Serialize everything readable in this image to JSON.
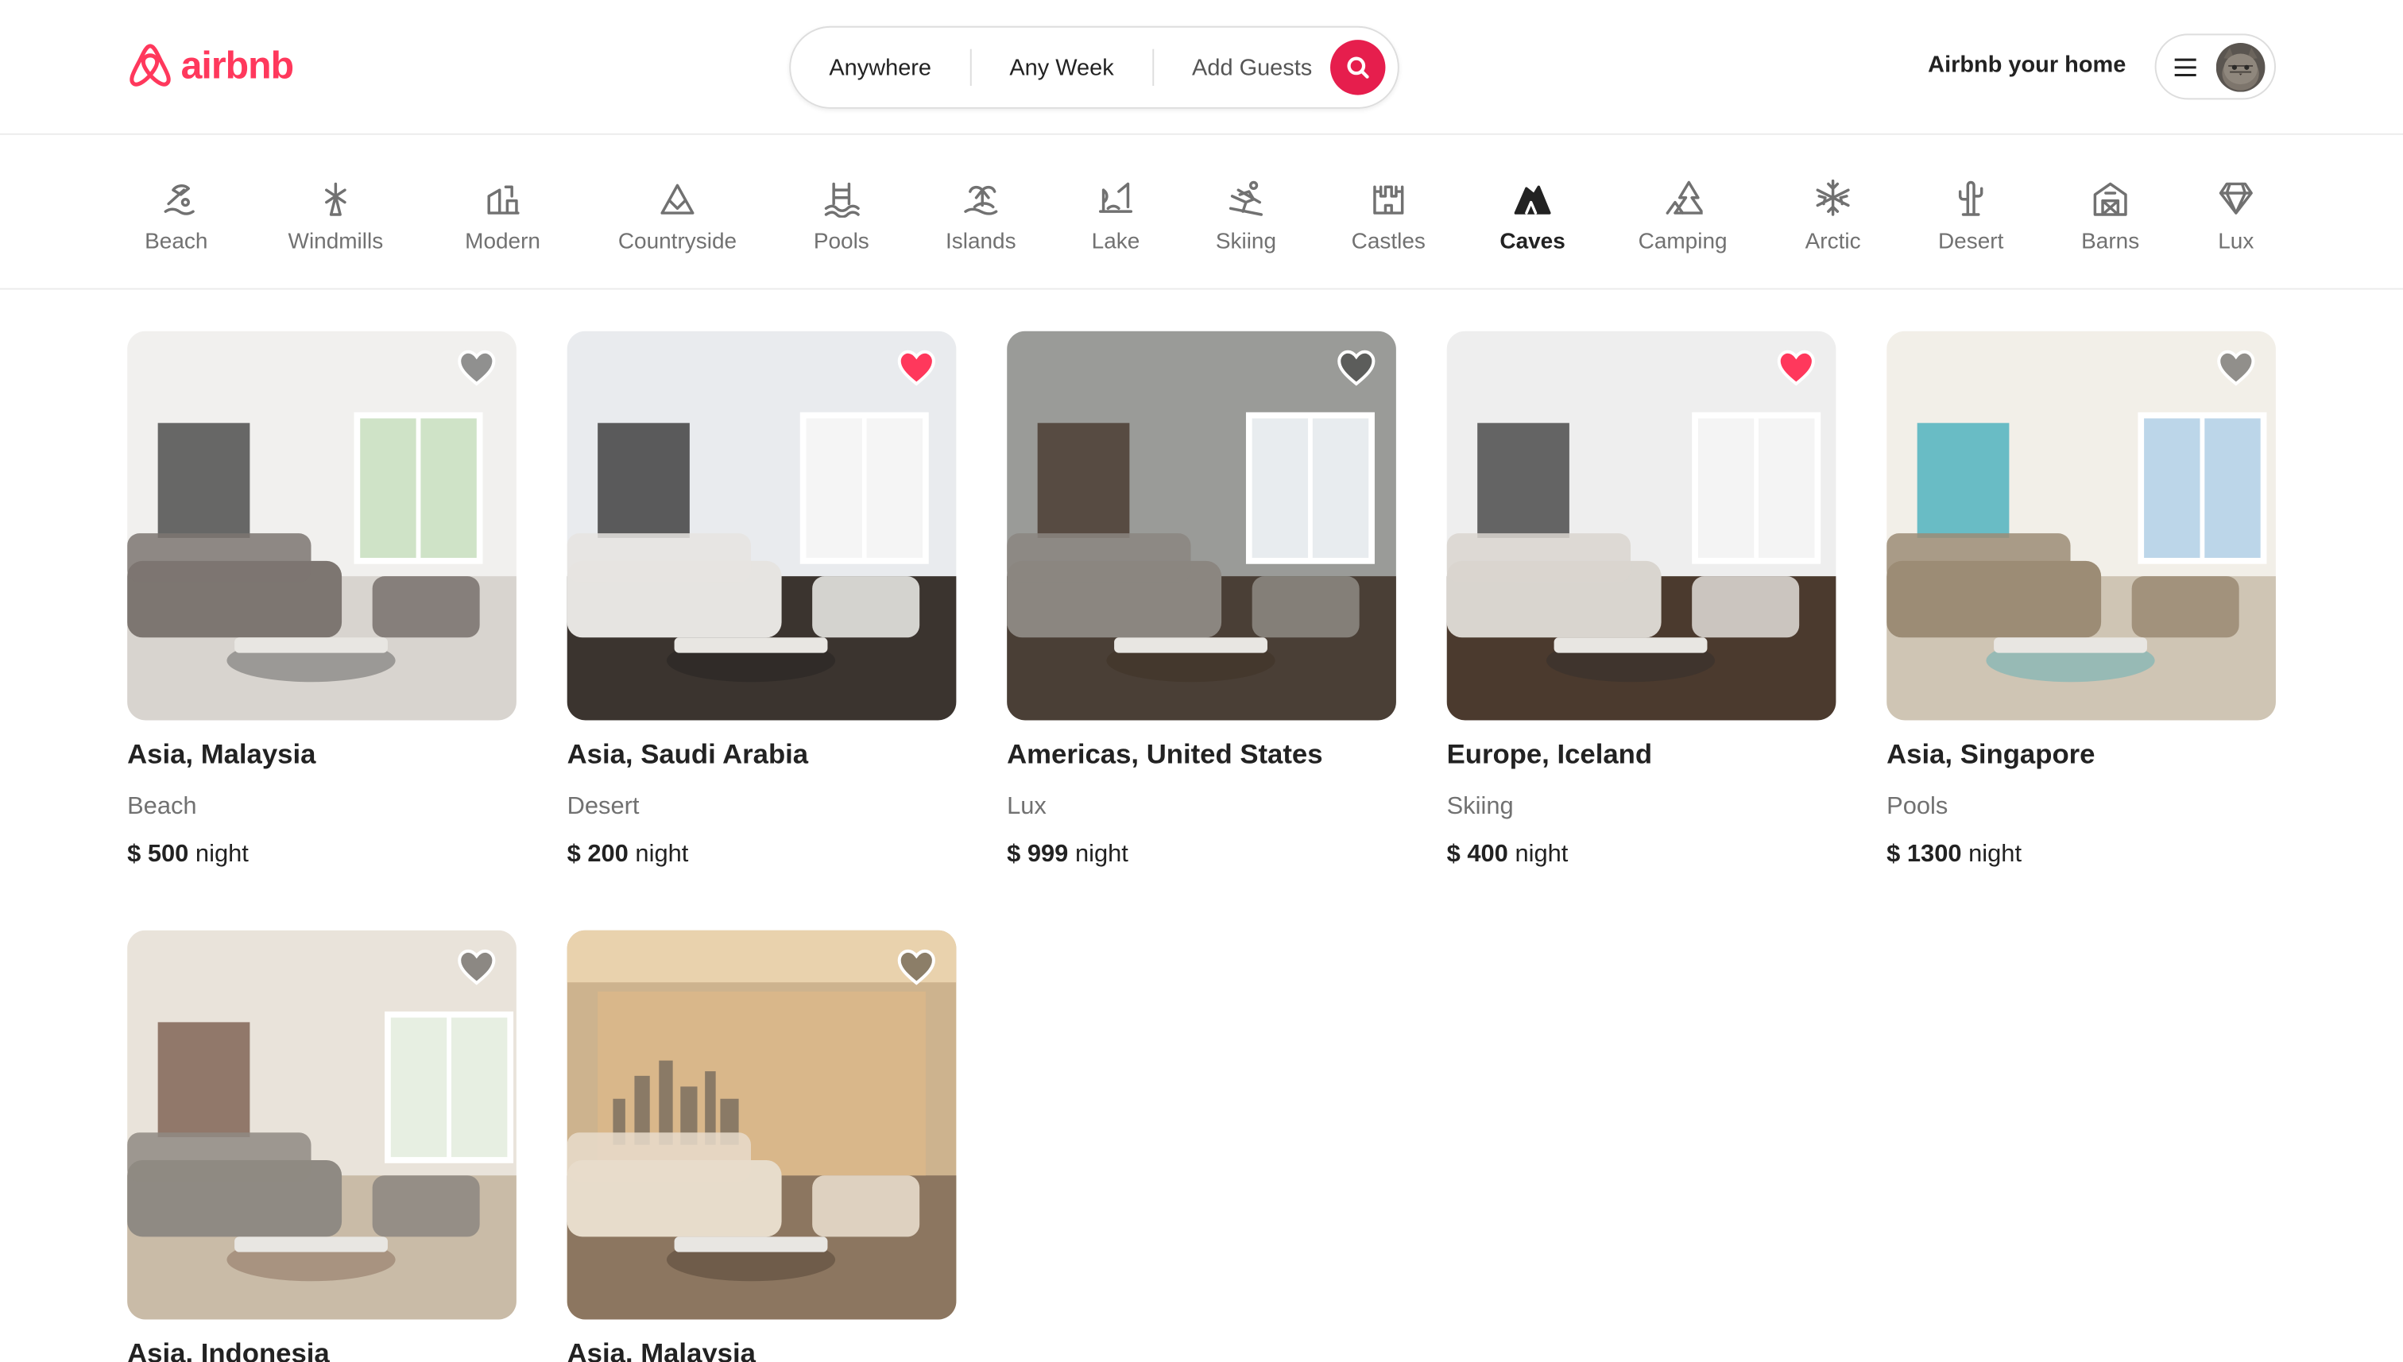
{
  "header": {
    "logo_text": "airbnb",
    "search": {
      "where": "Anywhere",
      "when": "Any Week",
      "who": "Add Guests"
    },
    "host_link": "Airbnb your home"
  },
  "categories": [
    {
      "label": "Beach",
      "icon": "beach-icon"
    },
    {
      "label": "Windmills",
      "icon": "windmill-icon"
    },
    {
      "label": "Modern",
      "icon": "modern-house-icon"
    },
    {
      "label": "Countryside",
      "icon": "mountain-icon"
    },
    {
      "label": "Pools",
      "icon": "pool-icon"
    },
    {
      "label": "Islands",
      "icon": "island-icon"
    },
    {
      "label": "Lake",
      "icon": "lake-icon"
    },
    {
      "label": "Skiing",
      "icon": "skiing-icon"
    },
    {
      "label": "Castles",
      "icon": "castle-icon"
    },
    {
      "label": "Caves",
      "icon": "cave-icon",
      "active": true
    },
    {
      "label": "Camping",
      "icon": "camping-icon"
    },
    {
      "label": "Arctic",
      "icon": "snowflake-icon"
    },
    {
      "label": "Desert",
      "icon": "cactus-icon"
    },
    {
      "label": "Barns",
      "icon": "barn-icon"
    },
    {
      "label": "Lux",
      "icon": "diamond-icon"
    }
  ],
  "listings": [
    {
      "location": "Asia, Malaysia",
      "category": "Beach",
      "currency": "$",
      "price": "500",
      "unit": "night",
      "favorited": false
    },
    {
      "location": "Asia, Saudi Arabia",
      "category": "Desert",
      "currency": "$",
      "price": "200",
      "unit": "night",
      "favorited": true
    },
    {
      "location": "Americas, United States",
      "category": "Lux",
      "currency": "$",
      "price": "999",
      "unit": "night",
      "favorited": false
    },
    {
      "location": "Europe, Iceland",
      "category": "Skiing",
      "currency": "$",
      "price": "400",
      "unit": "night",
      "favorited": true
    },
    {
      "location": "Asia, Singapore",
      "category": "Pools",
      "currency": "$",
      "price": "1300",
      "unit": "night",
      "favorited": false
    },
    {
      "location": "Asia, Indonesia",
      "favorited": false
    },
    {
      "location": "Asia, Malaysia",
      "favorited": false
    }
  ],
  "colors": {
    "brand": "#ff385c",
    "search_button": "#e61e4d",
    "heart_filled": "#ff385c"
  }
}
